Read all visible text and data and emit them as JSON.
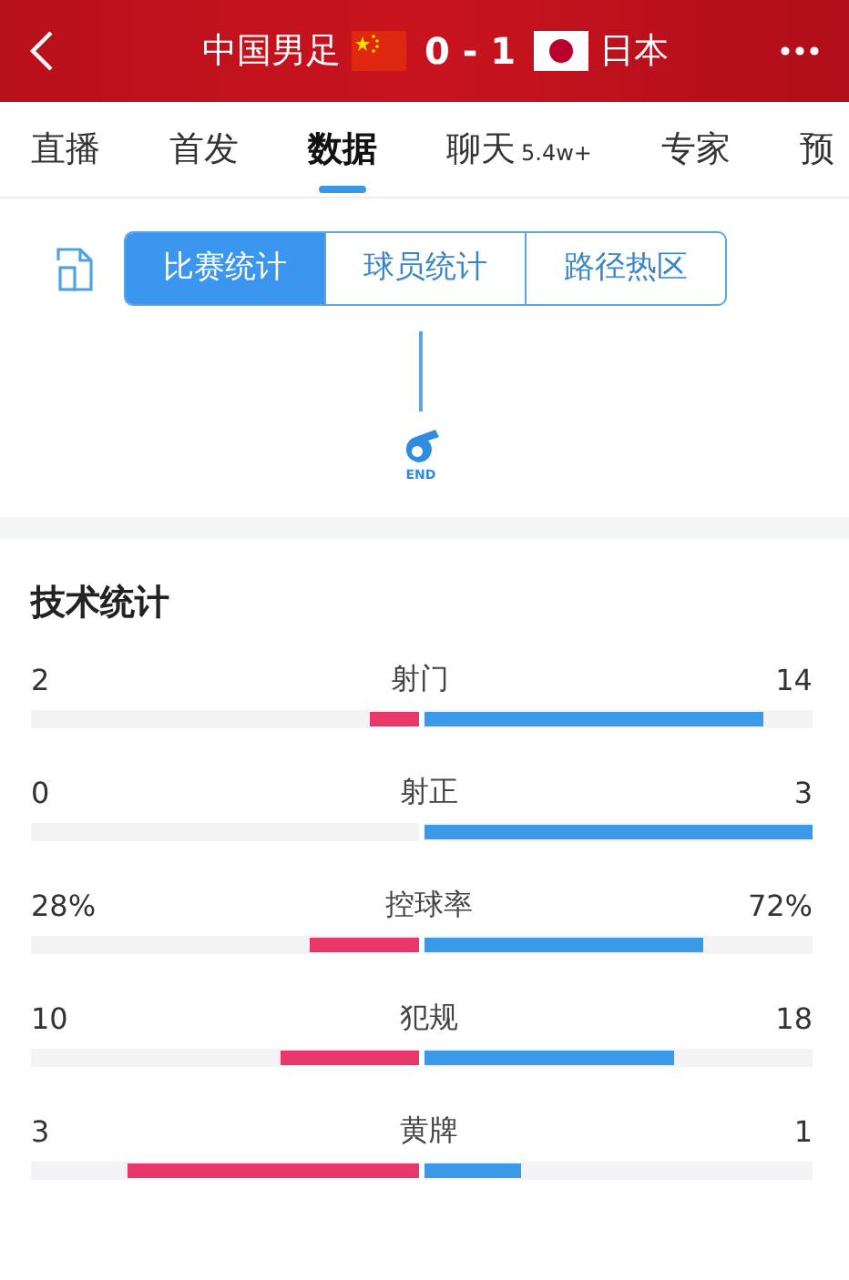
{
  "header": {
    "home_team": "中国男足",
    "score": "0 - 1",
    "away_team": "日本"
  },
  "tabs": [
    {
      "label": "直播",
      "selected": false
    },
    {
      "label": "首发",
      "selected": false
    },
    {
      "label": "数据",
      "selected": true
    },
    {
      "label": "聊天",
      "badge": "5.4w+",
      "selected": false
    },
    {
      "label": "专家",
      "selected": false
    },
    {
      "label": "预",
      "selected": false
    }
  ],
  "segments": [
    {
      "label": "比赛统计",
      "selected": true
    },
    {
      "label": "球员统计",
      "selected": false
    },
    {
      "label": "路径热区",
      "selected": false
    }
  ],
  "timeline": {
    "end_label": "END"
  },
  "section_title": "技术统计",
  "stats": [
    {
      "name": "射门",
      "home": "2",
      "away": "14",
      "home_bar": {
        "level": 0.125
      },
      "away_bar": {
        "level": 0.875
      }
    },
    {
      "name": "射正",
      "home": "0",
      "away": "3",
      "home_bar": {
        "level": 0
      },
      "away_bar": {
        "level": 1
      }
    },
    {
      "name": "控球率",
      "home": "28%",
      "away": "72%",
      "home_bar": {
        "level": 0.28
      },
      "away_bar": {
        "level": 0.72
      }
    },
    {
      "name": "犯规",
      "home": "10",
      "away": "18",
      "home_bar": {
        "level": 0.357
      },
      "away_bar": {
        "level": 0.643
      }
    },
    {
      "name": "黄牌",
      "home": "3",
      "away": "1",
      "home_bar": {
        "level": 0.75
      },
      "away_bar": {
        "level": 0.25
      }
    }
  ]
}
